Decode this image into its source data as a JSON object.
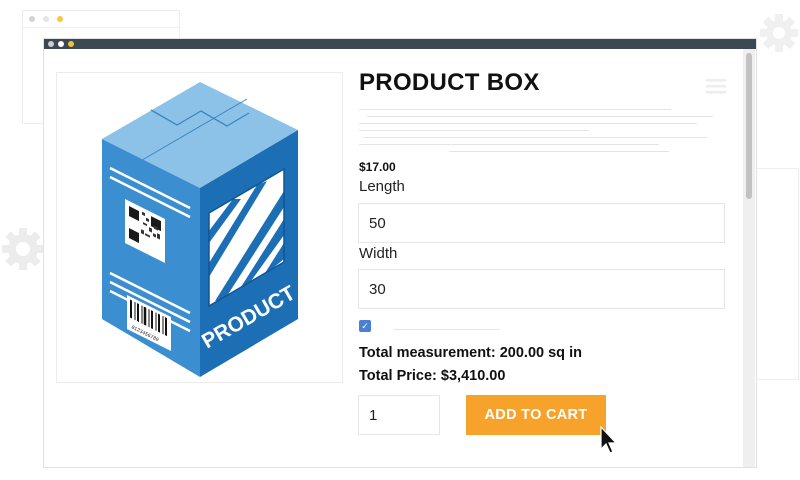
{
  "product": {
    "title": "PRODUCT BOX",
    "price": "$17.00",
    "box_label": "PRODUCT",
    "barcode_text": "0123456789"
  },
  "fields": {
    "length_label": "Length",
    "length_value": "50",
    "width_label": "Width",
    "width_value": "30"
  },
  "options": {
    "checkbox_checked": true
  },
  "summary": {
    "measurement": "Total measurement: 200.00 sq in",
    "total_price": "Total Price: $3,410.00"
  },
  "cart": {
    "quantity": "1",
    "add_label": "ADD TO CART"
  },
  "colors": {
    "accent": "#f7a22b",
    "titlebar": "#3d4951",
    "box_blue": "#2f86c9",
    "checkbox": "#4a7fd4"
  },
  "icons": {
    "menu": "hamburger-icon",
    "settings": "gear-icon",
    "cursor": "pointer-cursor-icon"
  }
}
